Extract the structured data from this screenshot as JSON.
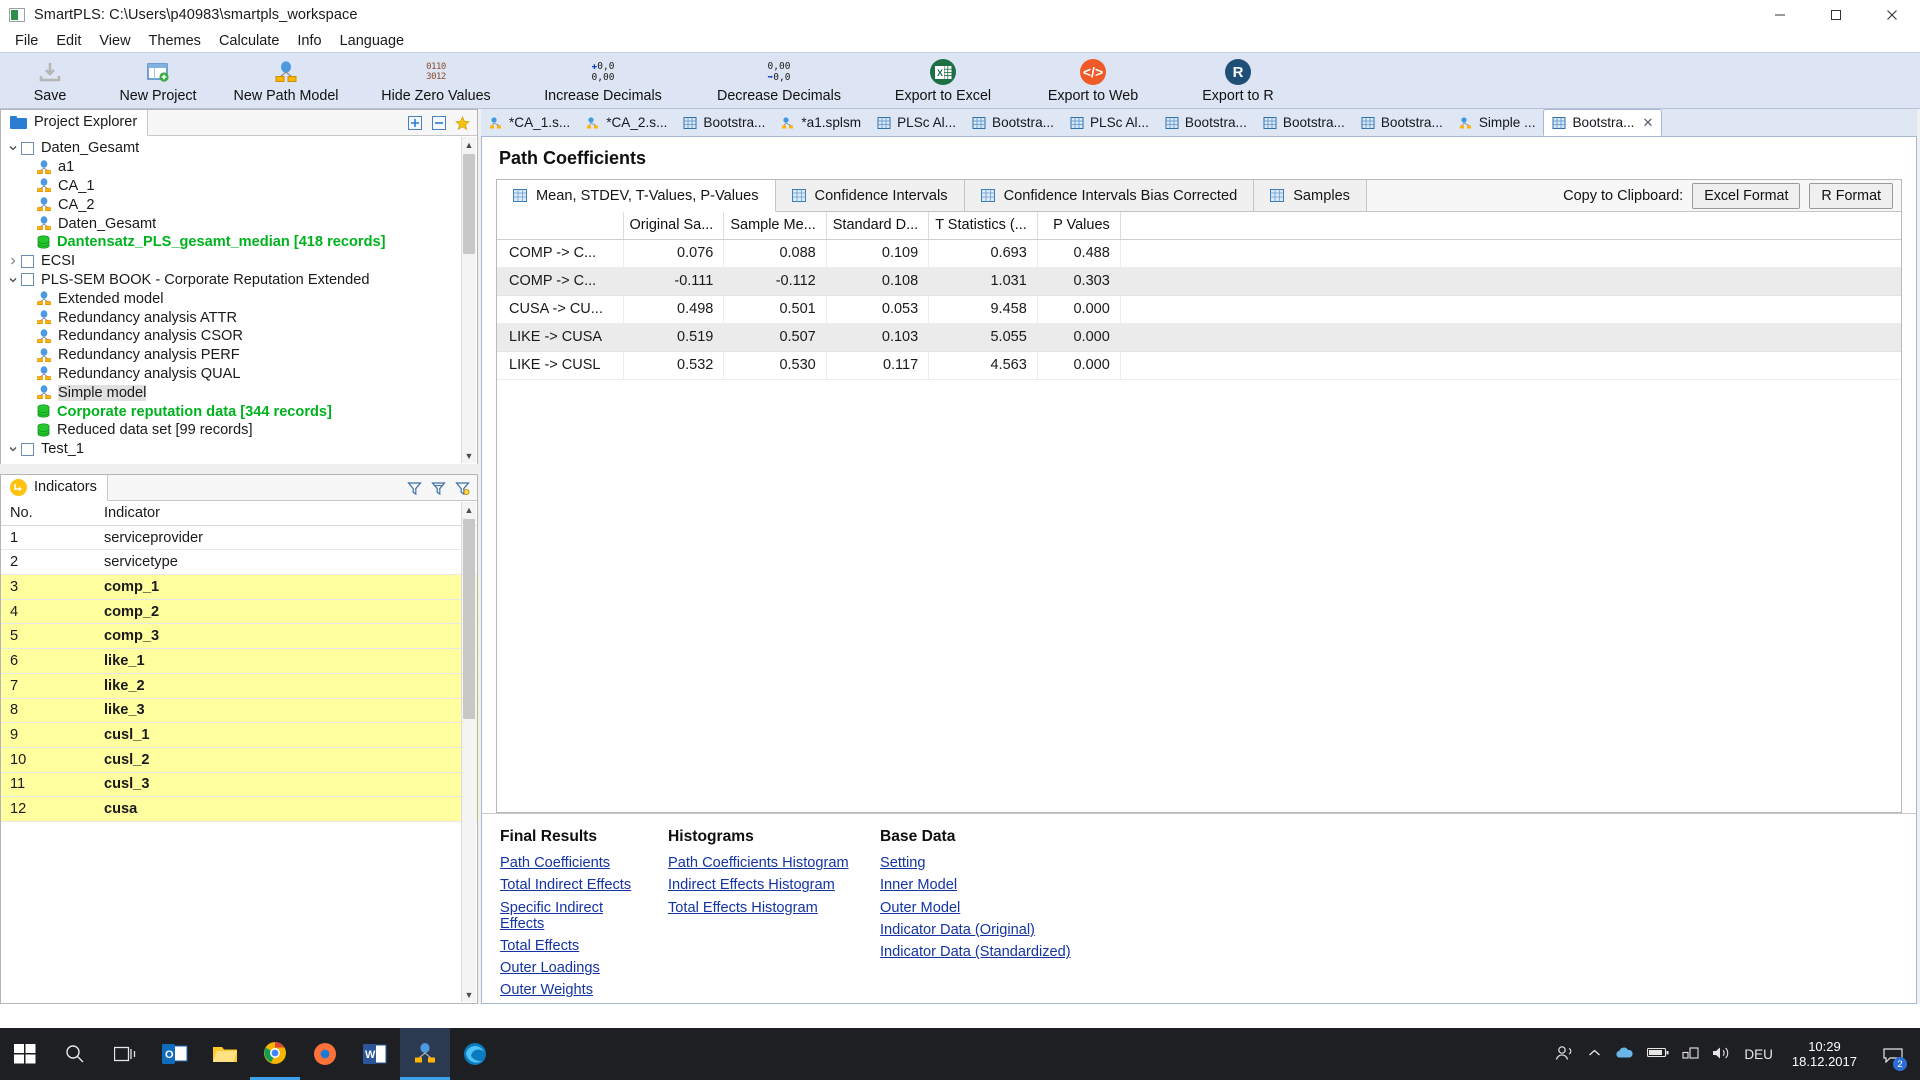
{
  "window": {
    "title": "SmartPLS: C:\\Users\\p40983\\smartpls_workspace",
    "minimize": "–",
    "maximize": "□",
    "close": "✕"
  },
  "menubar": [
    "File",
    "Edit",
    "View",
    "Themes",
    "Calculate",
    "Info",
    "Language"
  ],
  "toolbar": [
    {
      "label": "Save",
      "icon": "save-icon"
    },
    {
      "label": "New Project",
      "icon": "new-project-icon"
    },
    {
      "label": "New Path Model",
      "icon": "new-path-model-icon"
    },
    {
      "label": "Hide Zero Values",
      "icon": "hide-zero-values-icon",
      "glyph_top": "0110",
      "glyph_bottom": "3012"
    },
    {
      "label": "Increase Decimals",
      "icon": "increase-decimals-icon",
      "glyph_top": "0,0",
      "glyph_bottom": "0,00"
    },
    {
      "label": "Decrease Decimals",
      "icon": "decrease-decimals-icon",
      "glyph_top": "0,00",
      "glyph_bottom": "0,0"
    },
    {
      "label": "Export to Excel",
      "icon": "excel-icon"
    },
    {
      "label": "Export to Web",
      "icon": "web-code-icon"
    },
    {
      "label": "Export to R",
      "icon": "r-icon"
    }
  ],
  "project_explorer": {
    "tab_label": "Project Explorer",
    "tools": [
      "expand-all-icon",
      "collapse-all-icon",
      "favorite-icon"
    ],
    "tree": [
      {
        "label": "Daten_Gesamt",
        "type": "project",
        "twisty": "down",
        "level": 0
      },
      {
        "label": "a1",
        "type": "model",
        "level": 1
      },
      {
        "label": "CA_1",
        "type": "model",
        "level": 1
      },
      {
        "label": "CA_2",
        "type": "model",
        "level": 1
      },
      {
        "label": "Daten_Gesamt",
        "type": "model",
        "level": 1
      },
      {
        "label": "Dantensatz_PLS_gesamt_median [418 records]",
        "type": "data",
        "level": 1,
        "style": "green-bold"
      },
      {
        "label": "ECSI",
        "type": "project",
        "twisty": "right",
        "level": 0
      },
      {
        "label": "PLS-SEM BOOK - Corporate Reputation Extended",
        "type": "project",
        "twisty": "down",
        "level": 0
      },
      {
        "label": "Extended model",
        "type": "model",
        "level": 1
      },
      {
        "label": "Redundancy analysis ATTR",
        "type": "model",
        "level": 1
      },
      {
        "label": "Redundancy analysis CSOR",
        "type": "model",
        "level": 1
      },
      {
        "label": "Redundancy analysis PERF",
        "type": "model",
        "level": 1
      },
      {
        "label": "Redundancy analysis QUAL",
        "type": "model",
        "level": 1
      },
      {
        "label": "Simple model",
        "type": "model",
        "level": 1,
        "style": "selected"
      },
      {
        "label": "Corporate reputation data [344 records]",
        "type": "data",
        "level": 1,
        "style": "green-bold"
      },
      {
        "label": "Reduced data set [99 records]",
        "type": "data",
        "level": 1
      },
      {
        "label": "Test_1",
        "type": "project",
        "twisty": "down",
        "level": 0
      }
    ]
  },
  "indicators": {
    "tab_label": "Indicators",
    "tools": [
      "filter-icon-1",
      "filter-icon-2",
      "filter-icon-3"
    ],
    "columns": [
      "No.",
      "Indicator"
    ],
    "rows": [
      {
        "no": "1",
        "name": "serviceprovider",
        "highlight": false
      },
      {
        "no": "2",
        "name": "servicetype",
        "highlight": false
      },
      {
        "no": "3",
        "name": "comp_1",
        "highlight": true
      },
      {
        "no": "4",
        "name": "comp_2",
        "highlight": true
      },
      {
        "no": "5",
        "name": "comp_3",
        "highlight": true
      },
      {
        "no": "6",
        "name": "like_1",
        "highlight": true
      },
      {
        "no": "7",
        "name": "like_2",
        "highlight": true
      },
      {
        "no": "8",
        "name": "like_3",
        "highlight": true
      },
      {
        "no": "9",
        "name": "cusl_1",
        "highlight": true
      },
      {
        "no": "10",
        "name": "cusl_2",
        "highlight": true
      },
      {
        "no": "11",
        "name": "cusl_3",
        "highlight": true
      },
      {
        "no": "12",
        "name": "cusa",
        "highlight": true
      }
    ]
  },
  "editor_tabs": [
    {
      "label": "*CA_1.s...",
      "icon": "model-tab-icon",
      "active": false
    },
    {
      "label": "*CA_2.s...",
      "icon": "model-tab-icon",
      "active": false
    },
    {
      "label": "Bootstra...",
      "icon": "table-tab-icon",
      "active": false
    },
    {
      "label": "*a1.splsm",
      "icon": "model-tab-icon",
      "active": false
    },
    {
      "label": "PLSc Al...",
      "icon": "table-tab-icon",
      "active": false
    },
    {
      "label": "Bootstra...",
      "icon": "table-tab-icon",
      "active": false
    },
    {
      "label": "PLSc Al...",
      "icon": "table-tab-icon",
      "active": false
    },
    {
      "label": "Bootstra...",
      "icon": "table-tab-icon",
      "active": false
    },
    {
      "label": "Bootstra...",
      "icon": "table-tab-icon",
      "active": false
    },
    {
      "label": "Bootstra...",
      "icon": "table-tab-icon",
      "active": false
    },
    {
      "label": "Simple ...",
      "icon": "model-tab-icon",
      "active": false
    },
    {
      "label": "Bootstra...",
      "icon": "table-tab-icon",
      "active": true,
      "close": "✕"
    }
  ],
  "results": {
    "title": "Path Coefficients",
    "tabs": [
      {
        "label": "Mean, STDEV, T-Values, P-Values",
        "active": true
      },
      {
        "label": "Confidence Intervals",
        "active": false
      },
      {
        "label": "Confidence Intervals Bias Corrected",
        "active": false
      },
      {
        "label": "Samples",
        "active": false
      }
    ],
    "clipboard_label": "Copy to Clipboard:",
    "clipboard_buttons": [
      "Excel Format",
      "R Format"
    ],
    "table": {
      "columns": [
        "",
        "Original Sa...",
        "Sample Me...",
        "Standard D...",
        "T Statistics (...",
        "P Values"
      ],
      "rows": [
        [
          "COMP -> C...",
          "0.076",
          "0.088",
          "0.109",
          "0.693",
          "0.488"
        ],
        [
          "COMP -> C...",
          "-0.111",
          "-0.112",
          "0.108",
          "1.031",
          "0.303"
        ],
        [
          "CUSA -> CU...",
          "0.498",
          "0.501",
          "0.053",
          "9.458",
          "0.000"
        ],
        [
          "LIKE -> CUSA",
          "0.519",
          "0.507",
          "0.103",
          "5.055",
          "0.000"
        ],
        [
          "LIKE -> CUSL",
          "0.532",
          "0.530",
          "0.117",
          "4.563",
          "0.000"
        ]
      ]
    }
  },
  "link_columns": [
    {
      "heading": "Final Results",
      "links": [
        "Path Coefficients",
        "Total Indirect Effects",
        "Specific Indirect Effects",
        "Total Effects",
        "Outer Loadings",
        "Outer Weights"
      ]
    },
    {
      "heading": "Histograms",
      "links": [
        "Path Coefficients Histogram",
        "Indirect Effects Histogram",
        "Total Effects Histogram"
      ]
    },
    {
      "heading": "Base Data",
      "links": [
        "Setting",
        "Inner Model",
        "Outer Model",
        "Indicator Data (Original)",
        "Indicator Data (Standardized)"
      ]
    }
  ],
  "taskbar": {
    "items": [
      "start-icon",
      "search-icon",
      "task-view-icon",
      "outlook-icon",
      "explorer-icon",
      "chrome-icon",
      "firefox-icon",
      "word-icon",
      "smartpls-icon",
      "edge-icon"
    ],
    "tray": [
      "people-icon",
      "chevron-up-icon",
      "onedrive-icon",
      "battery-icon",
      "network-icon",
      "volume-icon"
    ],
    "language": "DEU",
    "time": "10:29",
    "date": "18.12.2017",
    "notification_count": "2"
  },
  "colors": {
    "toolbar_bg": "#dde4f3",
    "tab_bg": "#dfe6f4",
    "highlight_yellow": "#ffffa0",
    "link_blue": "#1434a4",
    "green": "#00b31e",
    "accent": "#2b7cd3"
  }
}
